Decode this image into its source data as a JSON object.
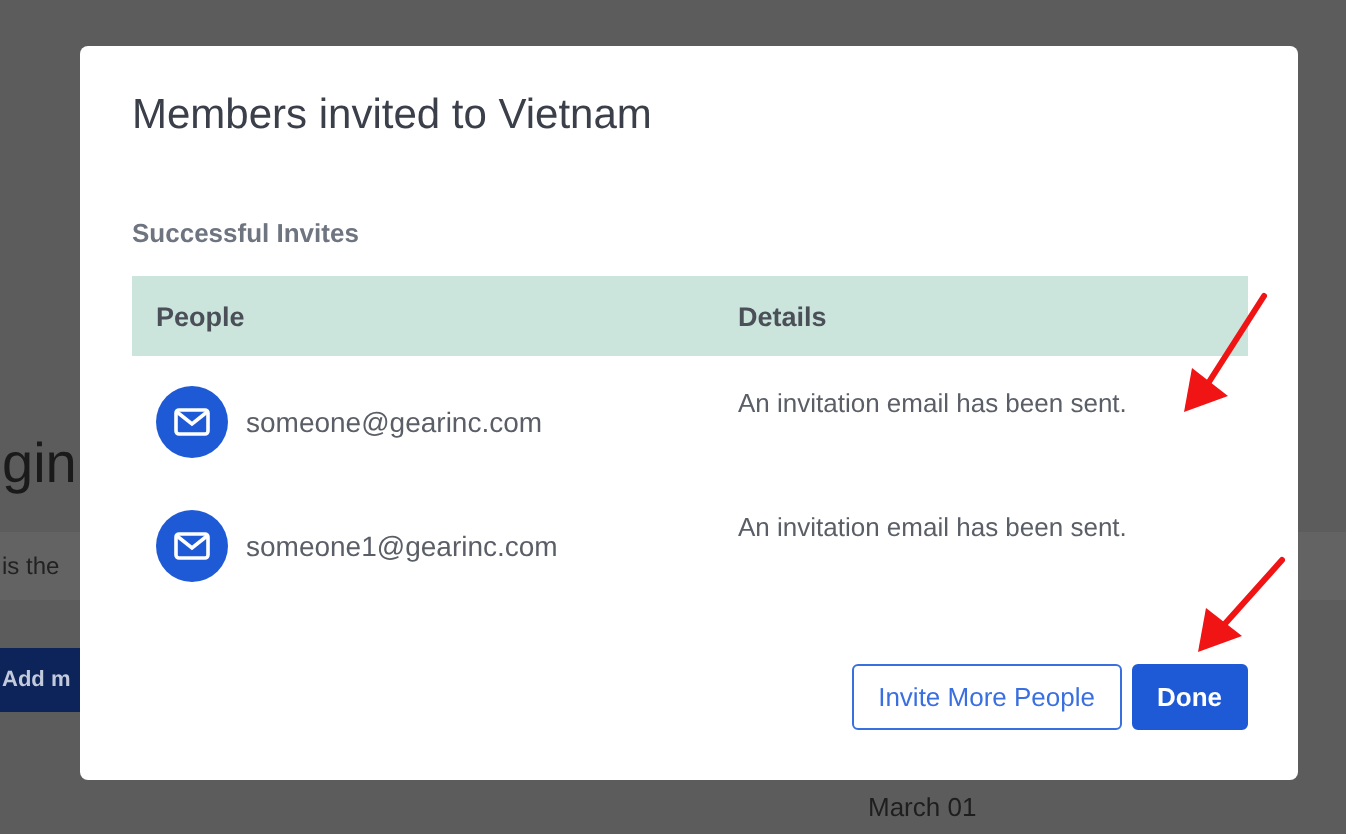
{
  "background": {
    "heading": "gin",
    "text": "is the",
    "button": "Add m",
    "date": "March 01"
  },
  "dialog": {
    "title": "Members invited to Vietnam",
    "section_title": "Successful Invites",
    "columns": [
      "People",
      "Details"
    ],
    "rows": [
      {
        "person": "someone@gearinc.com",
        "details": "An invitation email has been sent."
      },
      {
        "person": "someone1@gearinc.com",
        "details": "An invitation email has been sent."
      }
    ],
    "buttons": [
      {
        "label": "Invite More People",
        "kind": "secondary"
      },
      {
        "label": "Done",
        "kind": "primary"
      }
    ]
  }
}
